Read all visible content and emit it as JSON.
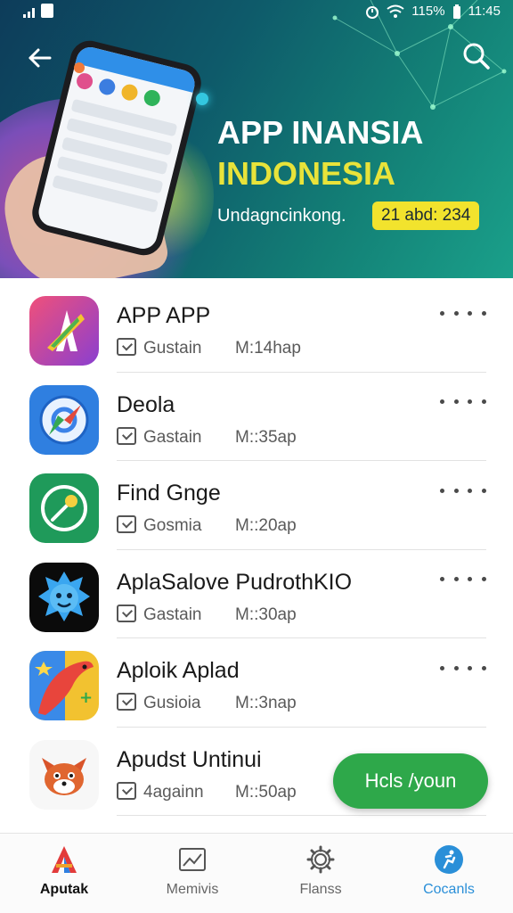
{
  "status_bar": {
    "battery": "115%",
    "time": "11:45"
  },
  "hero": {
    "title": "APP INANSIA",
    "subtitle": "INDONESIA",
    "tagline": "Undagncinkong.",
    "badge": "21 abd: 234",
    "colors": {
      "title": "#ffffff",
      "subtitle": "#e8e33a",
      "badge_bg": "#f2e32d"
    }
  },
  "apps": [
    {
      "title": "APP APP",
      "author": "Gustain",
      "size": "M:14hap",
      "icon": "app-app-icon"
    },
    {
      "title": "Deola",
      "author": "Gastain",
      "size": "M::35ap",
      "icon": "compass-icon"
    },
    {
      "title": "Find Gnge",
      "author": "Gosmia",
      "size": "M::20ap",
      "icon": "find-icon"
    },
    {
      "title": "AplaSalove PudrothKIO",
      "author": "Gastain",
      "size": "M::30ap",
      "icon": "blue-monster-icon"
    },
    {
      "title": "Aploik Aplad",
      "author": "Gusioia",
      "size": "M::3nap",
      "icon": "bird-icon"
    },
    {
      "title": "Apudst Untinui",
      "author": "4againn",
      "size": "M::50ap",
      "icon": "fox-icon"
    }
  ],
  "fab": {
    "label": "Hcls /youn",
    "color": "#2ea84a"
  },
  "bottom_nav": [
    {
      "label": "Aputak",
      "icon": "aputak-logo-icon"
    },
    {
      "label": "Memivis",
      "icon": "chart-image-icon"
    },
    {
      "label": "Flanss",
      "icon": "gear-icon"
    },
    {
      "label": "Cocanls",
      "icon": "cocanls-icon",
      "active": true
    }
  ],
  "accent_color": "#2a8fd8"
}
